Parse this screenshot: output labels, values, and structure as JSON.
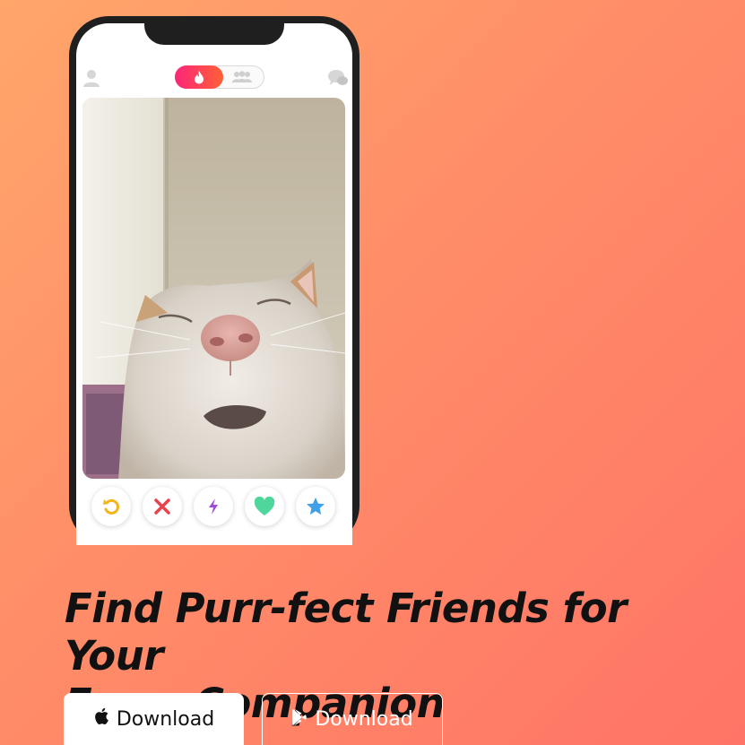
{
  "hero": {
    "headline_line1": "Find Purr-fect Friends for Your",
    "headline_line2": "Furry Companion"
  },
  "buttons": {
    "apple_label": "Download",
    "play_label": "Download"
  },
  "colors": {
    "bg_start": "#ffa66b",
    "bg_end": "#ff7466",
    "accent_pink": "#fd267a",
    "accent_orange": "#ff6036"
  },
  "phone": {
    "top_icons": [
      "profile-icon",
      "flame-icon",
      "people-icon",
      "chat-icon"
    ],
    "action_icons": [
      "rewind-icon",
      "nope-icon",
      "boost-icon",
      "like-icon",
      "super-like-icon"
    ]
  }
}
